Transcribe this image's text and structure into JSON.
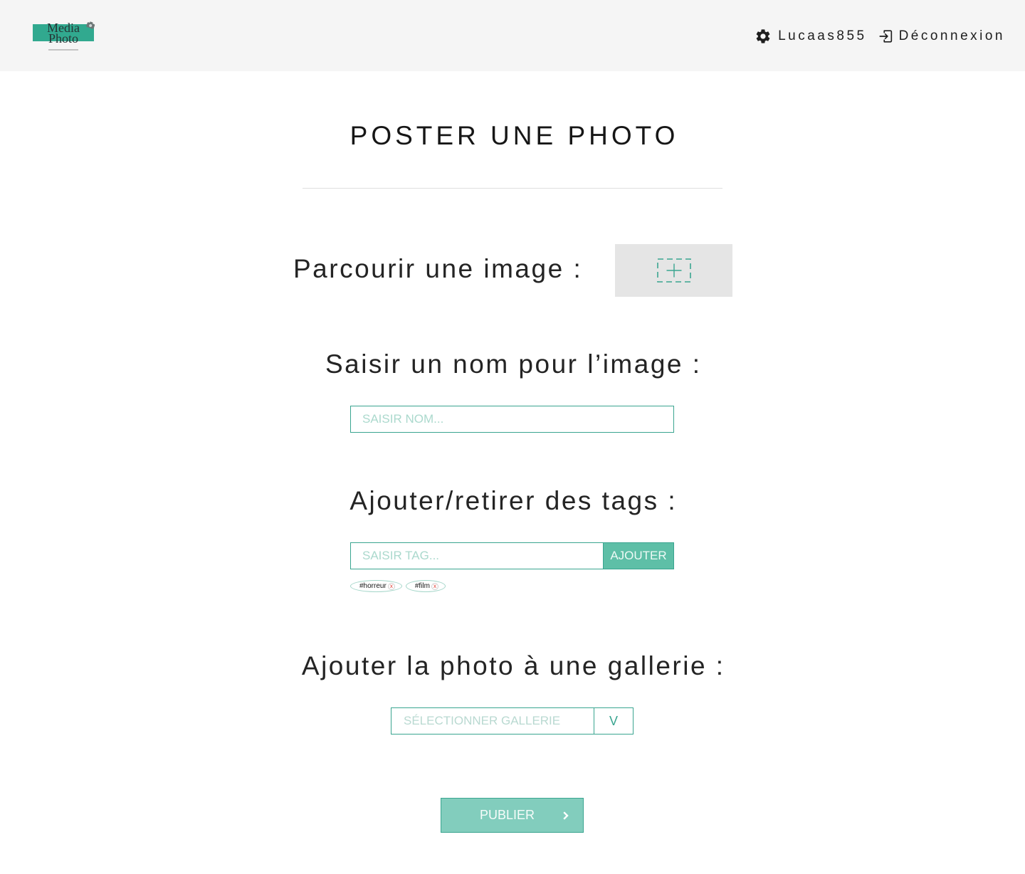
{
  "header": {
    "logo": {
      "line1": "Media",
      "line2": "Photo",
      "icon": "camera-icon"
    },
    "user": {
      "name": "Lucaas855",
      "icon": "gear-icon"
    },
    "logout": {
      "label": "Déconnexion",
      "icon": "logout-icon"
    }
  },
  "page_title": "POSTER UNE PHOTO",
  "upload": {
    "label": "Parcourir une image :",
    "icon": "add-image-icon"
  },
  "name_field": {
    "label": "Saisir un nom pour l’image :",
    "placeholder": "SAISIR NOM..."
  },
  "tags": {
    "label": "Ajouter/retirer des tags :",
    "placeholder": "SAISIR TAG...",
    "add_label": "AJOUTER",
    "items": [
      {
        "label": "#horreur",
        "remove": "x"
      },
      {
        "label": "#film",
        "remove": "x"
      }
    ]
  },
  "gallery": {
    "label": "Ajouter la photo à une gallerie :",
    "placeholder": "SÉLECTIONNER GALLERIE",
    "toggle": "V"
  },
  "publish": {
    "label": "PUBLIER",
    "icon": "chevron-right-icon"
  },
  "colors": {
    "accent": "#3aa590",
    "logo": "#31a98f",
    "add_button": "#5ebfa7",
    "publish_button": "#82cdbd",
    "placeholder": "#abd9cd",
    "header_bg": "#f5f5f5",
    "upload_bg": "#e5e5e5",
    "tag_remove": "#e0392f"
  }
}
